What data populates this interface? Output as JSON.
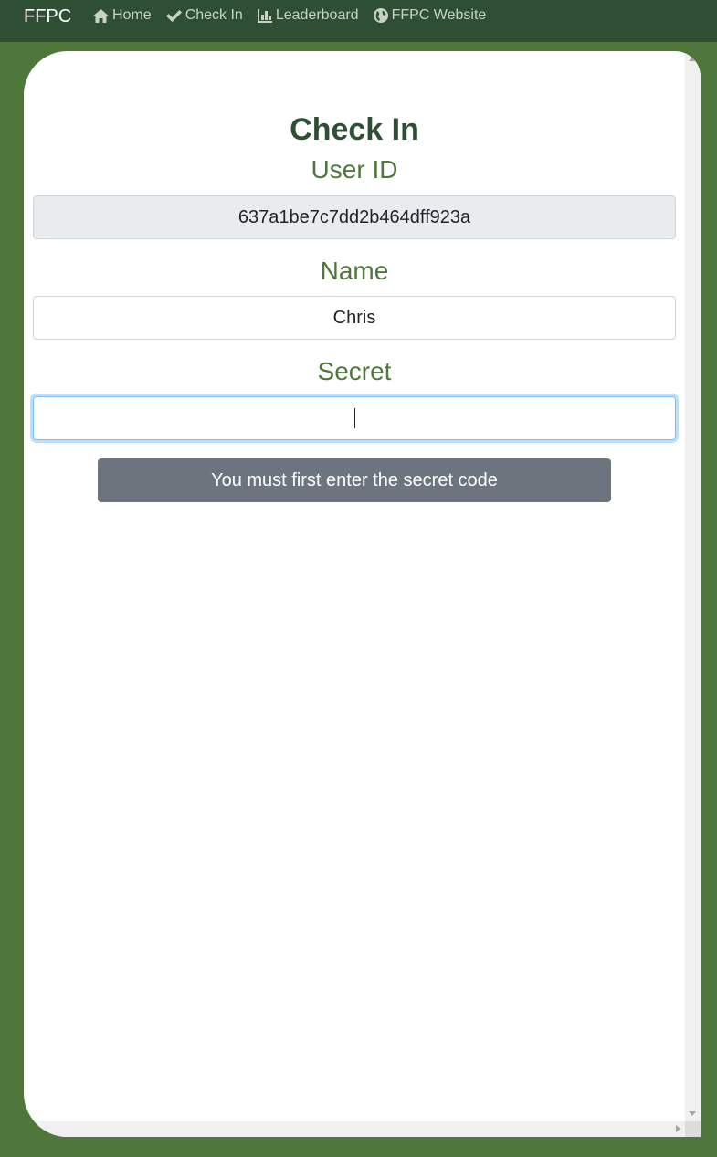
{
  "nav": {
    "brand": "FFPC",
    "links": [
      {
        "label": "Home",
        "icon": "home-icon"
      },
      {
        "label": "Check In",
        "icon": "check-icon"
      },
      {
        "label": "Leaderboard",
        "icon": "bar-chart-icon"
      },
      {
        "label": "FFPC Website",
        "icon": "globe-icon"
      }
    ]
  },
  "page": {
    "title": "Check In"
  },
  "form": {
    "user_id_label": "User ID",
    "user_id_value": "637a1be7c7dd2b464dff923a",
    "name_label": "Name",
    "name_value": "Chris",
    "secret_label": "Secret",
    "secret_value": "",
    "submit_label": "You must first enter the secret code"
  },
  "colors": {
    "background": "#4f773c",
    "navbar": "#2f4f35",
    "heading": "#2f4f35",
    "label": "#4f773c",
    "button": "#6c757d"
  }
}
